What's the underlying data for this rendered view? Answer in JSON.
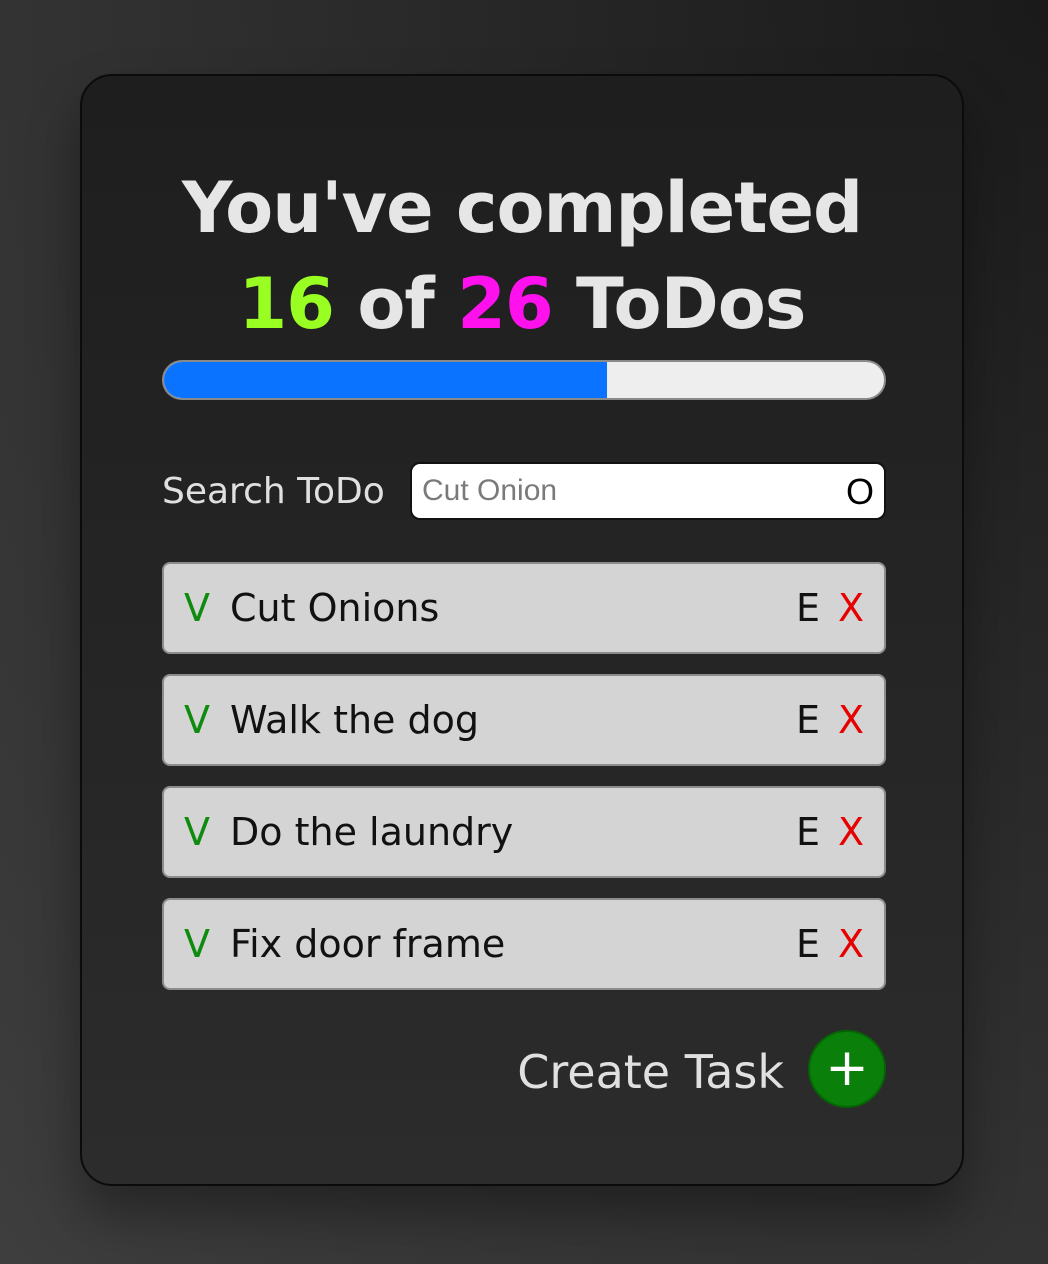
{
  "header": {
    "title_line1": "You've completed",
    "completed_count": "16",
    "of_word": "of",
    "total_count": "26",
    "todos_word": "ToDos",
    "completed_color": "#99ff22",
    "total_color": "#ff11ee"
  },
  "progress": {
    "fraction": 0.615,
    "fill_color": "#0a73ff"
  },
  "search": {
    "label": "Search ToDo",
    "placeholder": "Cut Onion",
    "value": "",
    "icon": "O"
  },
  "todos": [
    {
      "check_icon": "V",
      "text": "Cut Onions",
      "edit_label": "E",
      "delete_label": "X"
    },
    {
      "check_icon": "V",
      "text": "Walk the dog",
      "edit_label": "E",
      "delete_label": "X"
    },
    {
      "check_icon": "V",
      "text": "Do the laundry",
      "edit_label": "E",
      "delete_label": "X"
    },
    {
      "check_icon": "V",
      "text": "Fix door frame",
      "edit_label": "E",
      "delete_label": "X"
    }
  ],
  "create": {
    "label": "Create Task",
    "button_icon": "+",
    "button_color": "#0a7f0a"
  }
}
